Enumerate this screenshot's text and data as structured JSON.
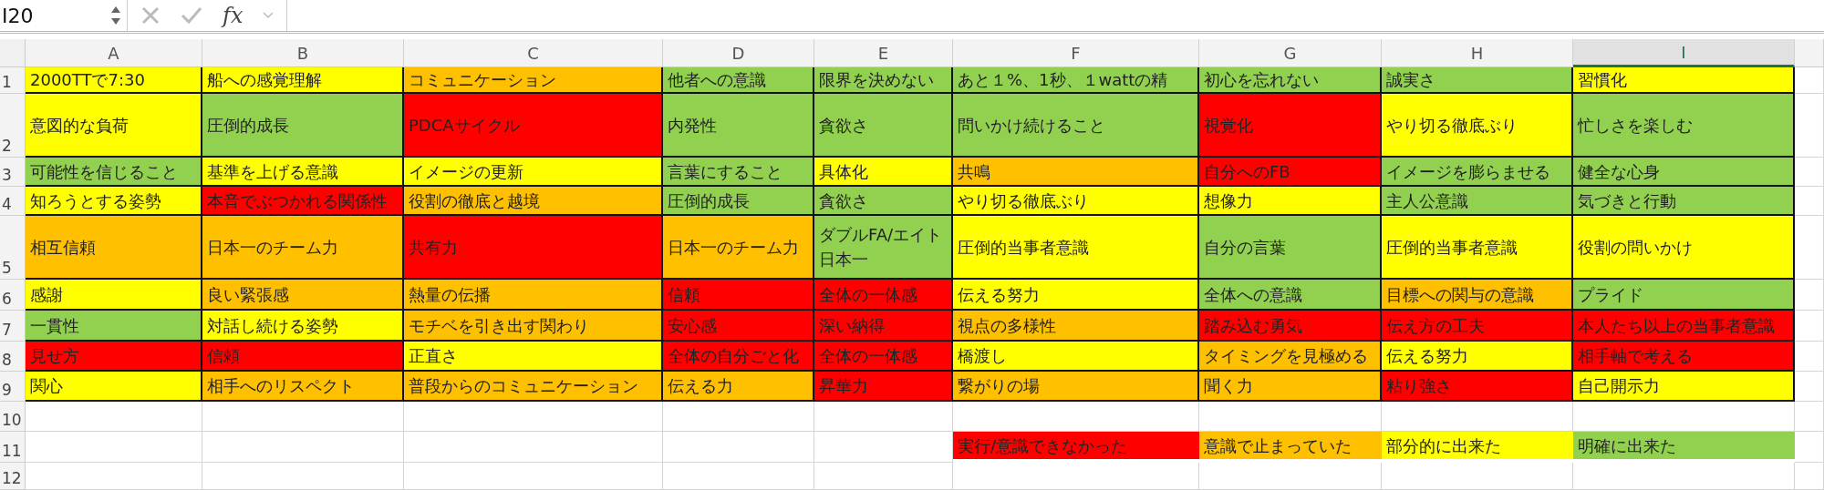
{
  "formula_bar": {
    "name_box": "I20",
    "function_label": "fx"
  },
  "columns": [
    {
      "label": "A",
      "selected": false
    },
    {
      "label": "B",
      "selected": false
    },
    {
      "label": "C",
      "selected": false
    },
    {
      "label": "D",
      "selected": false
    },
    {
      "label": "E",
      "selected": false
    },
    {
      "label": "F",
      "selected": false
    },
    {
      "label": "G",
      "selected": false
    },
    {
      "label": "H",
      "selected": false
    },
    {
      "label": "I",
      "selected": true
    }
  ],
  "rows": [
    {
      "number": "1",
      "cells": [
        {
          "text": "2000TTで7:30",
          "color": "#ffff00"
        },
        {
          "text": "船への感覚理解",
          "color": "#ffff00"
        },
        {
          "text": "コミュニケーション",
          "color": "#ffc000"
        },
        {
          "text": "他者への意識",
          "color": "#92d050"
        },
        {
          "text": "限界を決めない",
          "color": "#92d050"
        },
        {
          "text": "あと１%、1秒、１wattの精",
          "color": "#92d050"
        },
        {
          "text": "初心を忘れない",
          "color": "#92d050"
        },
        {
          "text": "誠実さ",
          "color": "#92d050"
        },
        {
          "text": "習慣化",
          "color": "#ffff00"
        }
      ]
    },
    {
      "number": "2",
      "cells": [
        {
          "text": "意図的な負荷",
          "color": "#ffff00"
        },
        {
          "text": "圧倒的成長",
          "color": "#92d050"
        },
        {
          "text": "PDCAサイクル",
          "color": "#ff0000"
        },
        {
          "text": "内発性",
          "color": "#92d050"
        },
        {
          "text": "貪欲さ",
          "color": "#92d050"
        },
        {
          "text": "問いかけ続けること",
          "color": "#92d050"
        },
        {
          "text": "視覚化",
          "color": "#ff0000"
        },
        {
          "text": "やり切る徹底ぶり",
          "color": "#ffff00"
        },
        {
          "text": "忙しさを楽しむ",
          "color": "#92d050"
        }
      ]
    },
    {
      "number": "3",
      "cells": [
        {
          "text": "可能性を信じること",
          "color": "#92d050"
        },
        {
          "text": "基準を上げる意識",
          "color": "#ffff00"
        },
        {
          "text": "イメージの更新",
          "color": "#ffff00"
        },
        {
          "text": "言葉にすること",
          "color": "#92d050"
        },
        {
          "text": "具体化",
          "color": "#ffff00"
        },
        {
          "text": "共鳴",
          "color": "#ffc000"
        },
        {
          "text": "自分へのFB",
          "color": "#ff0000"
        },
        {
          "text": "イメージを膨らませる",
          "color": "#92d050"
        },
        {
          "text": "健全な心身",
          "color": "#92d050"
        }
      ]
    },
    {
      "number": "4",
      "cells": [
        {
          "text": "知ろうとする姿勢",
          "color": "#ffff00"
        },
        {
          "text": "本音でぶつかれる関係性",
          "color": "#ff0000"
        },
        {
          "text": "役割の徹底と越境",
          "color": "#ffc000"
        },
        {
          "text": "圧倒的成長",
          "color": "#92d050"
        },
        {
          "text": "貪欲さ",
          "color": "#92d050"
        },
        {
          "text": "やり切る徹底ぶり",
          "color": "#ffff00"
        },
        {
          "text": "想像力",
          "color": "#ffff00"
        },
        {
          "text": "主人公意識",
          "color": "#92d050"
        },
        {
          "text": "気づきと行動",
          "color": "#92d050"
        }
      ]
    },
    {
      "number": "5",
      "cells": [
        {
          "text": "相互信頼",
          "color": "#ffc000"
        },
        {
          "text": "日本一のチーム力",
          "color": "#ffc000"
        },
        {
          "text": "共有力",
          "color": "#ff0000"
        },
        {
          "text": "日本一のチーム力",
          "color": "#ffc000"
        },
        {
          "text": "ダブルFA/エイト日本一",
          "color": "#92d050"
        },
        {
          "text": "圧倒的当事者意識",
          "color": "#ffff00"
        },
        {
          "text": "自分の言葉",
          "color": "#92d050"
        },
        {
          "text": "圧倒的当事者意識",
          "color": "#ffff00"
        },
        {
          "text": "役割の問いかけ",
          "color": "#ffff00"
        }
      ]
    },
    {
      "number": "6",
      "cells": [
        {
          "text": "感謝",
          "color": "#ffff00"
        },
        {
          "text": "良い緊張感",
          "color": "#ffc000"
        },
        {
          "text": "熱量の伝播",
          "color": "#ffc000"
        },
        {
          "text": "信頼",
          "color": "#ff0000"
        },
        {
          "text": "全体の一体感",
          "color": "#ff0000"
        },
        {
          "text": "伝える努力",
          "color": "#ffff00"
        },
        {
          "text": "全体への意識",
          "color": "#92d050"
        },
        {
          "text": "目標への関与の意識",
          "color": "#ffc000"
        },
        {
          "text": "プライド",
          "color": "#92d050"
        }
      ]
    },
    {
      "number": "7",
      "cells": [
        {
          "text": "一貫性",
          "color": "#92d050"
        },
        {
          "text": "対話し続ける姿勢",
          "color": "#ffff00"
        },
        {
          "text": "モチベを引き出す関わり",
          "color": "#ffc000"
        },
        {
          "text": "安心感",
          "color": "#ff0000"
        },
        {
          "text": "深い納得",
          "color": "#ff0000"
        },
        {
          "text": "視点の多様性",
          "color": "#ffc000"
        },
        {
          "text": "踏み込む勇気",
          "color": "#ff0000"
        },
        {
          "text": "伝え方の工夫",
          "color": "#ff0000"
        },
        {
          "text": "本人たち以上の当事者意識",
          "color": "#ff0000"
        }
      ]
    },
    {
      "number": "8",
      "cells": [
        {
          "text": "見せ方",
          "color": "#ff0000"
        },
        {
          "text": "信頼",
          "color": "#ff0000"
        },
        {
          "text": "正直さ",
          "color": "#ffff00"
        },
        {
          "text": "全体の自分ごと化",
          "color": "#ff0000"
        },
        {
          "text": "全体の一体感",
          "color": "#ff0000"
        },
        {
          "text": "橋渡し",
          "color": "#ffff00"
        },
        {
          "text": "タイミングを見極める",
          "color": "#ffc000"
        },
        {
          "text": "伝える努力",
          "color": "#ffff00"
        },
        {
          "text": "相手軸で考える",
          "color": "#ff0000"
        }
      ]
    },
    {
      "number": "9",
      "cells": [
        {
          "text": "関心",
          "color": "#ffff00"
        },
        {
          "text": "相手へのリスペクト",
          "color": "#ffc000"
        },
        {
          "text": "普段からのコミュニケーション",
          "color": "#ffc000"
        },
        {
          "text": "伝える力",
          "color": "#ffc000"
        },
        {
          "text": "昇華力",
          "color": "#ff0000"
        },
        {
          "text": "繋がりの場",
          "color": "#ffc000"
        },
        {
          "text": "聞く力",
          "color": "#ffc000"
        },
        {
          "text": "粘り強さ",
          "color": "#ff0000"
        },
        {
          "text": "自己開示力",
          "color": "#ffff00"
        }
      ]
    },
    {
      "number": "10",
      "cells": []
    },
    {
      "number": "11",
      "cells": []
    },
    {
      "number": "12",
      "cells": []
    }
  ],
  "legend": [
    {
      "text": "実行/意識できなかった",
      "color": "#ff0000"
    },
    {
      "text": "意識で止まっていた",
      "color": "#ffc000"
    },
    {
      "text": "部分的に出来た",
      "color": "#ffff00"
    },
    {
      "text": "明確に出来た",
      "color": "#92d050"
    }
  ]
}
